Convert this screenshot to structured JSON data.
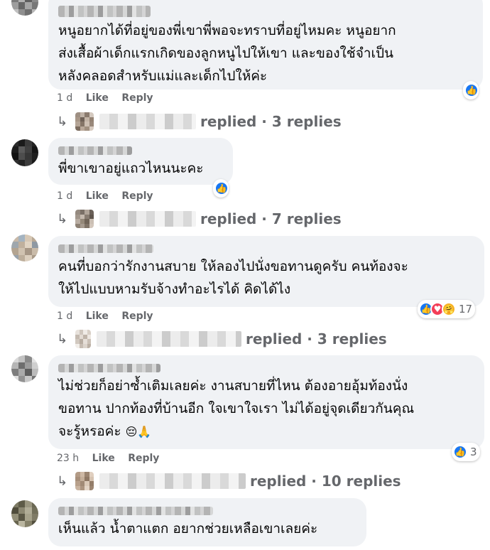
{
  "comments": [
    {
      "text_lines": [
        "หนูอยากได้ที่อยู่ของพี่เขาพี่พอจะทราบที่อยู่ไหมคะ หนูอยาก",
        "ส่งเสื้อผ้าเด็กแรกเกิดของลูกหนูไปให้เขา และของใช้จำเป็น",
        "หลังคลอดสำหรับแม่และเด็กไปให้ค่ะ"
      ],
      "time": "1 d",
      "like_label": "Like",
      "reply_label": "Reply",
      "reactions_count": "",
      "replies_text": "replied · 3 replies"
    },
    {
      "text_lines": [
        "พี่ขาเขาอยู่แถวไหนนะคะ"
      ],
      "time": "1 d",
      "like_label": "Like",
      "reply_label": "Reply",
      "reactions_count": "",
      "replies_text": "replied · 7 replies"
    },
    {
      "text_lines": [
        "คนที่บอกว่ารักงานสบาย ให้ลองไปนั่งขอทานดูครับ คนท้องจะ",
        "ให้ไปแบบหามรับจ้างทำอะไรได้ คิดได้ไง"
      ],
      "time": "1 d",
      "like_label": "Like",
      "reply_label": "Reply",
      "reactions_count": "17",
      "replies_text": "replied · 3 replies"
    },
    {
      "text_lines": [
        "ไม่ช่วยก็อย่าซ้ำเติมเลยค่ะ งานสบายที่ไหน ต้องอายอุ้มท้องนั่ง",
        "ขอทาน ปากท้องที่บ้านอีก ใจเขาใจเรา ไม่ได้อยู่จุดเดียวกันคุณ",
        "จะรู้หรอค่ะ"
      ],
      "emojis": "😔🙏",
      "time": "23 h",
      "like_label": "Like",
      "reply_label": "Reply",
      "reactions_count": "3",
      "replies_text": "replied · 10 replies"
    },
    {
      "text_lines": [
        "เห็นแล้ว น้ำตาแตก อยากช่วยเหลือเขาเลยค่ะ"
      ]
    }
  ],
  "icons": {
    "reply_arrow": "↳",
    "like": "👍",
    "love": "♥",
    "care": "🤗"
  },
  "colors": {
    "bubble_bg": "#f0f2f5",
    "meta_text": "#65676b",
    "like_blue": "#1877f2"
  }
}
